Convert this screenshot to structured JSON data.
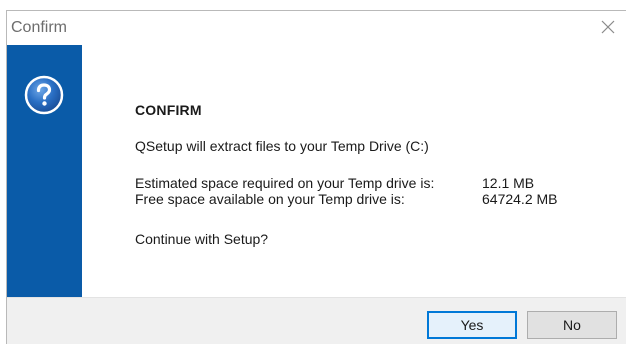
{
  "window": {
    "title": "Confirm",
    "close_icon": "close-icon"
  },
  "sidebar": {
    "icon": "question-icon",
    "color": "#0a5ba8"
  },
  "content": {
    "heading": "CONFIRM",
    "message": "QSetup will extract files to your Temp Drive (C:)",
    "required_label": "Estimated space required on your Temp drive is:",
    "required_value": "12.1 MB",
    "free_label": "Free space available on your Temp drive is:",
    "free_value": "64724.2 MB",
    "prompt": "Continue with Setup?"
  },
  "buttons": {
    "yes_label": "Yes",
    "no_label": "No",
    "accent": "#0078d7"
  }
}
